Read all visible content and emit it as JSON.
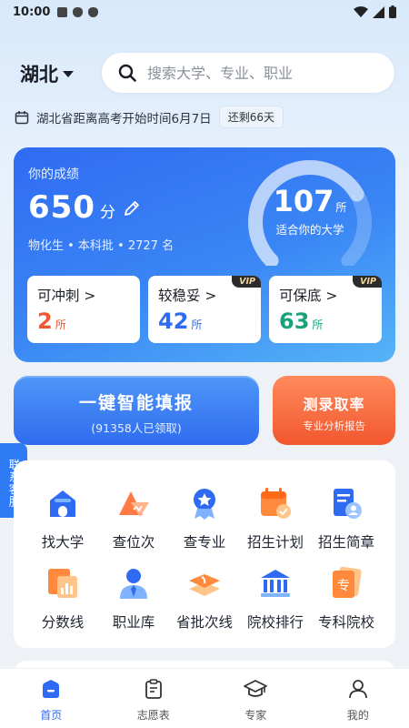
{
  "status_bar": {
    "time": "10:00"
  },
  "header": {
    "province": "湖北",
    "search_placeholder": "搜索大学、专业、职业"
  },
  "countdown": {
    "text": "湖北省距离高考开始时间6月7日",
    "remaining": "还剩66天"
  },
  "score_card": {
    "label": "你的成绩",
    "score": "650",
    "score_unit": "分",
    "meta": "物化生 • 本科批 • 2727 名",
    "match_count": "107",
    "match_unit": "所",
    "match_caption": "适合你的大学",
    "gauge_fraction": 0.72,
    "tiers": [
      {
        "title": "可冲刺 >",
        "count": "2",
        "unit": "所",
        "color": "#f2572f",
        "vip": ""
      },
      {
        "title": "较稳妥 >",
        "count": "42",
        "unit": "所",
        "color": "#2f6bf2",
        "vip": "VIP"
      },
      {
        "title": "可保底 >",
        "count": "63",
        "unit": "所",
        "color": "#1aa37a",
        "vip": "VIP"
      }
    ]
  },
  "actions": {
    "fill": {
      "title": "一键智能填报",
      "sub": "(91358人已领取)"
    },
    "test": {
      "title": "测录取率",
      "sub": "专业分析报告"
    }
  },
  "service_tab": "联系客服",
  "grid": {
    "items": [
      {
        "label": "找大学",
        "icon": "university-icon"
      },
      {
        "label": "查位次",
        "icon": "rank-chart-icon"
      },
      {
        "label": "查专业",
        "icon": "major-badge-icon"
      },
      {
        "label": "招生计划",
        "icon": "calendar-plan-icon"
      },
      {
        "label": "招生简章",
        "icon": "brochure-icon"
      },
      {
        "label": "分数线",
        "icon": "score-line-icon"
      },
      {
        "label": "职业库",
        "icon": "career-icon"
      },
      {
        "label": "省批次线",
        "icon": "batch-line-icon"
      },
      {
        "label": "院校排行",
        "icon": "ranking-icon"
      },
      {
        "label": "专科院校",
        "icon": "vocational-icon"
      }
    ]
  },
  "bottom_nav": [
    {
      "label": "首页",
      "icon": "home-icon",
      "active": true
    },
    {
      "label": "志愿表",
      "icon": "clipboard-icon",
      "active": false
    },
    {
      "label": "专家",
      "icon": "graduation-cap-icon",
      "active": false
    },
    {
      "label": "我的",
      "icon": "profile-icon",
      "active": false
    }
  ]
}
